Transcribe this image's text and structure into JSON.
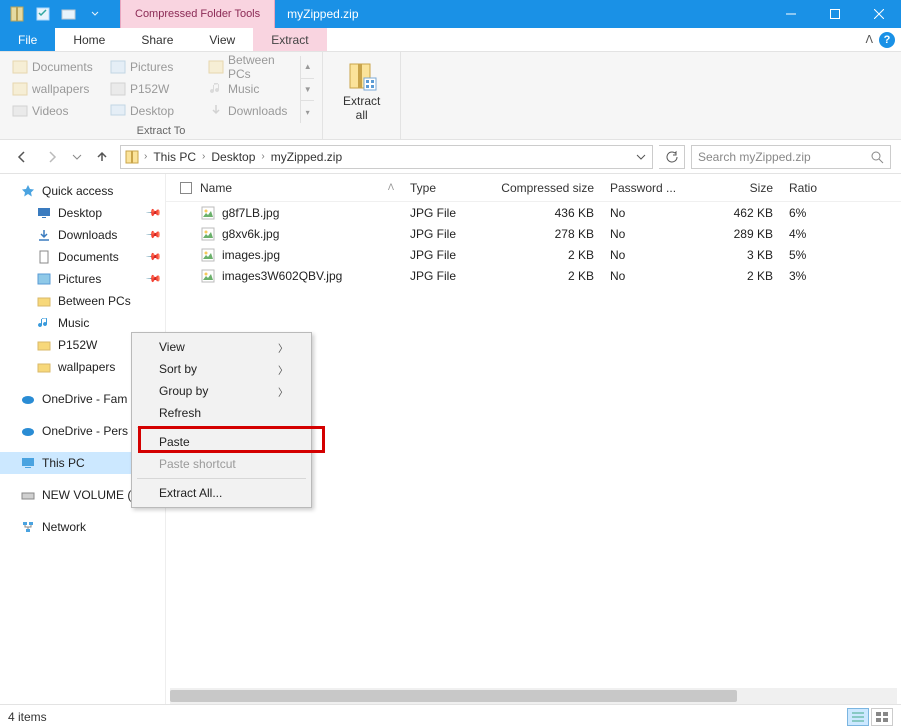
{
  "titlebar": {
    "context_tab": "Compressed Folder Tools",
    "title": "myZipped.zip"
  },
  "ribbon_tabs": {
    "file": "File",
    "home": "Home",
    "share": "Share",
    "view": "View",
    "extract": "Extract"
  },
  "ribbon": {
    "destinations": {
      "documents": "Documents",
      "pictures": "Pictures",
      "between_pcs": "Between PCs",
      "wallpapers": "wallpapers",
      "p152w": "P152W",
      "music": "Music",
      "videos": "Videos",
      "desktop": "Desktop",
      "downloads": "Downloads"
    },
    "extract_to_label": "Extract To",
    "extract_all": "Extract\nall"
  },
  "breadcrumb": {
    "this_pc": "This PC",
    "desktop": "Desktop",
    "zip": "myZipped.zip"
  },
  "search": {
    "placeholder": "Search myZipped.zip"
  },
  "columns": {
    "name": "Name",
    "type": "Type",
    "csize": "Compressed size",
    "pwd": "Password ...",
    "size": "Size",
    "ratio": "Ratio"
  },
  "files": [
    {
      "name": "g8f7LB.jpg",
      "type": "JPG File",
      "csize": "436 KB",
      "pwd": "No",
      "size": "462 KB",
      "ratio": "6%"
    },
    {
      "name": "g8xv6k.jpg",
      "type": "JPG File",
      "csize": "278 KB",
      "pwd": "No",
      "size": "289 KB",
      "ratio": "4%"
    },
    {
      "name": "images.jpg",
      "type": "JPG File",
      "csize": "2 KB",
      "pwd": "No",
      "size": "3 KB",
      "ratio": "5%"
    },
    {
      "name": "images3W602QBV.jpg",
      "type": "JPG File",
      "csize": "2 KB",
      "pwd": "No",
      "size": "2 KB",
      "ratio": "3%"
    }
  ],
  "sidebar": {
    "quick_access": "Quick access",
    "desktop": "Desktop",
    "downloads": "Downloads",
    "documents": "Documents",
    "pictures": "Pictures",
    "between_pcs": "Between PCs",
    "music": "Music",
    "p152w": "P152W",
    "wallpapers": "wallpapers",
    "onedrive_fam": "OneDrive - Fam",
    "onedrive_pers": "OneDrive - Pers",
    "this_pc": "This PC",
    "new_volume": "NEW VOLUME (E:)",
    "network": "Network"
  },
  "context_menu": {
    "view": "View",
    "sort_by": "Sort by",
    "group_by": "Group by",
    "refresh": "Refresh",
    "paste": "Paste",
    "paste_shortcut": "Paste shortcut",
    "extract_all": "Extract All..."
  },
  "status": {
    "items": "4 items"
  }
}
